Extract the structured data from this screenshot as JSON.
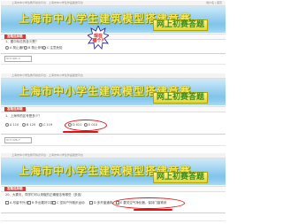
{
  "panel1": {
    "header_left": "上海市中小学生教育综合平台 · 上海市中小学生作品报送平台",
    "header_right": "用户名 | 首页",
    "title": "上海市中小学生建筑模型搭建竞赛",
    "subtitle": "网上初赛答题",
    "section": "答题选择题",
    "question": "1、图中标志的含义是？",
    "options": [
      "A 禁止通行",
      "B 禁止停车",
      "C 注意危险"
    ],
    "input_value": "9c7c401-3",
    "badge_text": "现在 哪个?"
  },
  "panel2": {
    "header_left": "上海市中小学生教育综合平台 · 上海市中小学生作品报送平台",
    "title": "上海市中小学生建筑模型搭建竞赛",
    "subtitle": "网上初赛答题",
    "section": "答题选择题",
    "question": "1、上海市的区号是多少？",
    "options": [
      "A 110",
      "B 120",
      "C 119",
      "D 021",
      "E 010"
    ],
    "input_value": "9c7c126-7"
  },
  "panel3": {
    "header_left": "上海市中小学生教育综合平台 · 上海市中小学生作品报送平台",
    "title": "上海市中小学生建筑模型搭建竞赛",
    "subtitle": "网上初赛答题",
    "section": "答题选择题",
    "question": "20、大雾天，同学们可以采取的正确做法有哪些（多选）",
    "options": [
      "A 尽量不外出",
      "B 外出戴好口罩",
      "C 坚持户外跑步运动",
      "D 多开窗通风",
      "E 要关空气净化器，保持门窗紧闭"
    ]
  },
  "colors": {
    "title_text": "#f6e85a",
    "subtitle_bg": "#e3d336",
    "subtitle_text": "#3d8c1e",
    "section_tab": "#d83b2d",
    "annotation": "#e51010"
  }
}
